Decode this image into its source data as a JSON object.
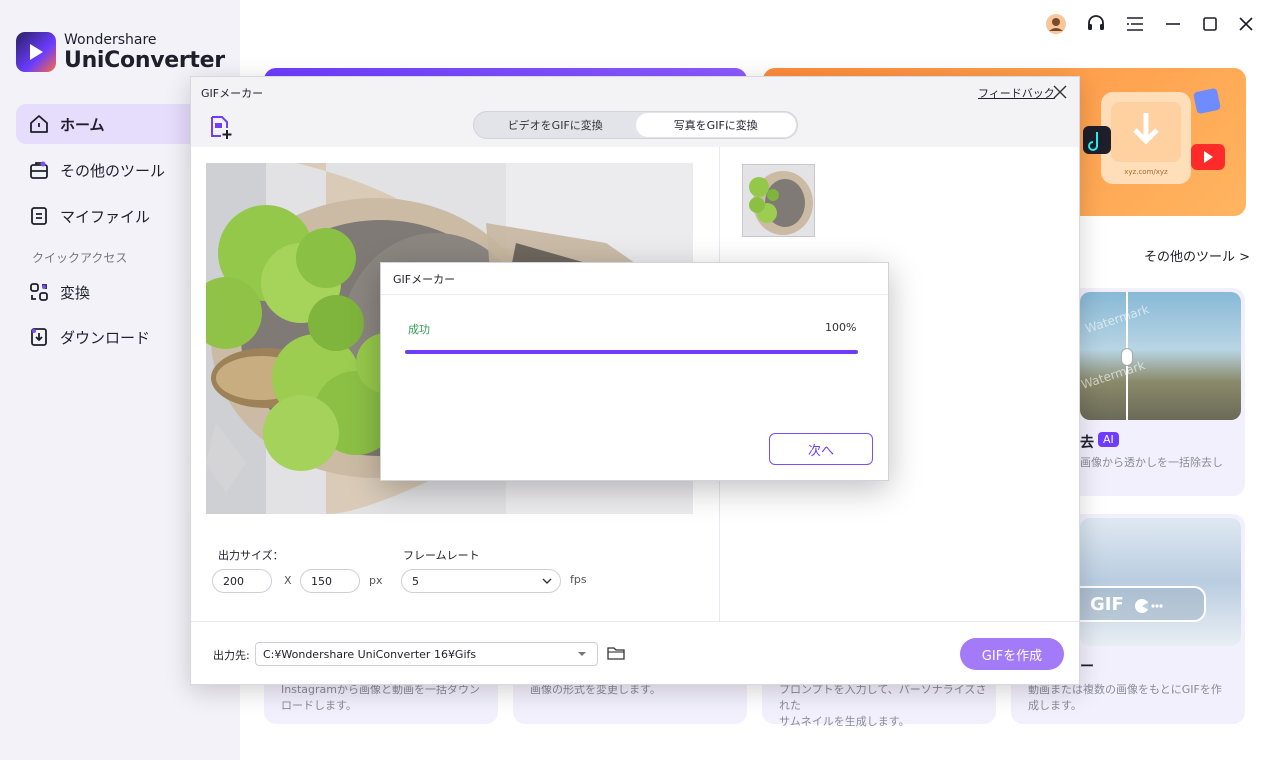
{
  "app": {
    "brand": "Wondershare",
    "product": "UniConverter"
  },
  "sidebar": {
    "items": [
      {
        "label": "ホーム",
        "icon": "home-icon",
        "active": true
      },
      {
        "label": "その他のツール",
        "icon": "toolbox-icon"
      },
      {
        "label": "マイファイル",
        "icon": "file-icon"
      }
    ],
    "section_label": "クイックアクセス",
    "quick_items": [
      {
        "label": "変換",
        "icon": "convert-icon"
      },
      {
        "label": "ダウンロード",
        "icon": "download-icon"
      }
    ]
  },
  "main": {
    "more_tools": "その他のツール  >",
    "cards": {
      "watermark_title": "去",
      "watermark_badge": "AI",
      "watermark_desc": "画像から透かしを一括除去し",
      "watermark_overlay": "Watermark",
      "gif_card_overlay": "GIF",
      "desc_instagram": "Instagramから画像と動画を一括ダウン\nロードします。",
      "desc_image": "画像の形式を変更します。",
      "desc_thumbnail": "プロンプトを入力して、パーソナライズされた\nサムネイルを生成します。",
      "desc_gif": "動画または複数の画像をもとにGIFを作\n成します。",
      "gif_title_tail": "ー",
      "banner_url": "xyz.com/xyz"
    }
  },
  "gif_window": {
    "title": "GIFメーカー",
    "feedback": "フィードバック",
    "tabs": [
      {
        "label": "ビデオをGIFに変換",
        "active": false
      },
      {
        "label": "写真をGIFに変換",
        "active": true
      }
    ],
    "output_size_label": "出力サイズ：",
    "width": "200",
    "x_label": "X",
    "height": "150",
    "px_unit": "px",
    "frame_rate_label": "フレームレート",
    "frame_rate": "5",
    "fps_unit": "fps",
    "output_label": "出力先:",
    "output_path": "C:¥Wondershare UniConverter 16¥Gifs",
    "create_button": "GIFを作成"
  },
  "progress_modal": {
    "title": "GIFメーカー",
    "status": "成功",
    "percent_label": "100%",
    "progress": 1.0,
    "next_button": "次へ"
  },
  "colors": {
    "accent": "#6e3dff",
    "success": "#2e9e4f",
    "orange_banner": "#ff9a45"
  }
}
